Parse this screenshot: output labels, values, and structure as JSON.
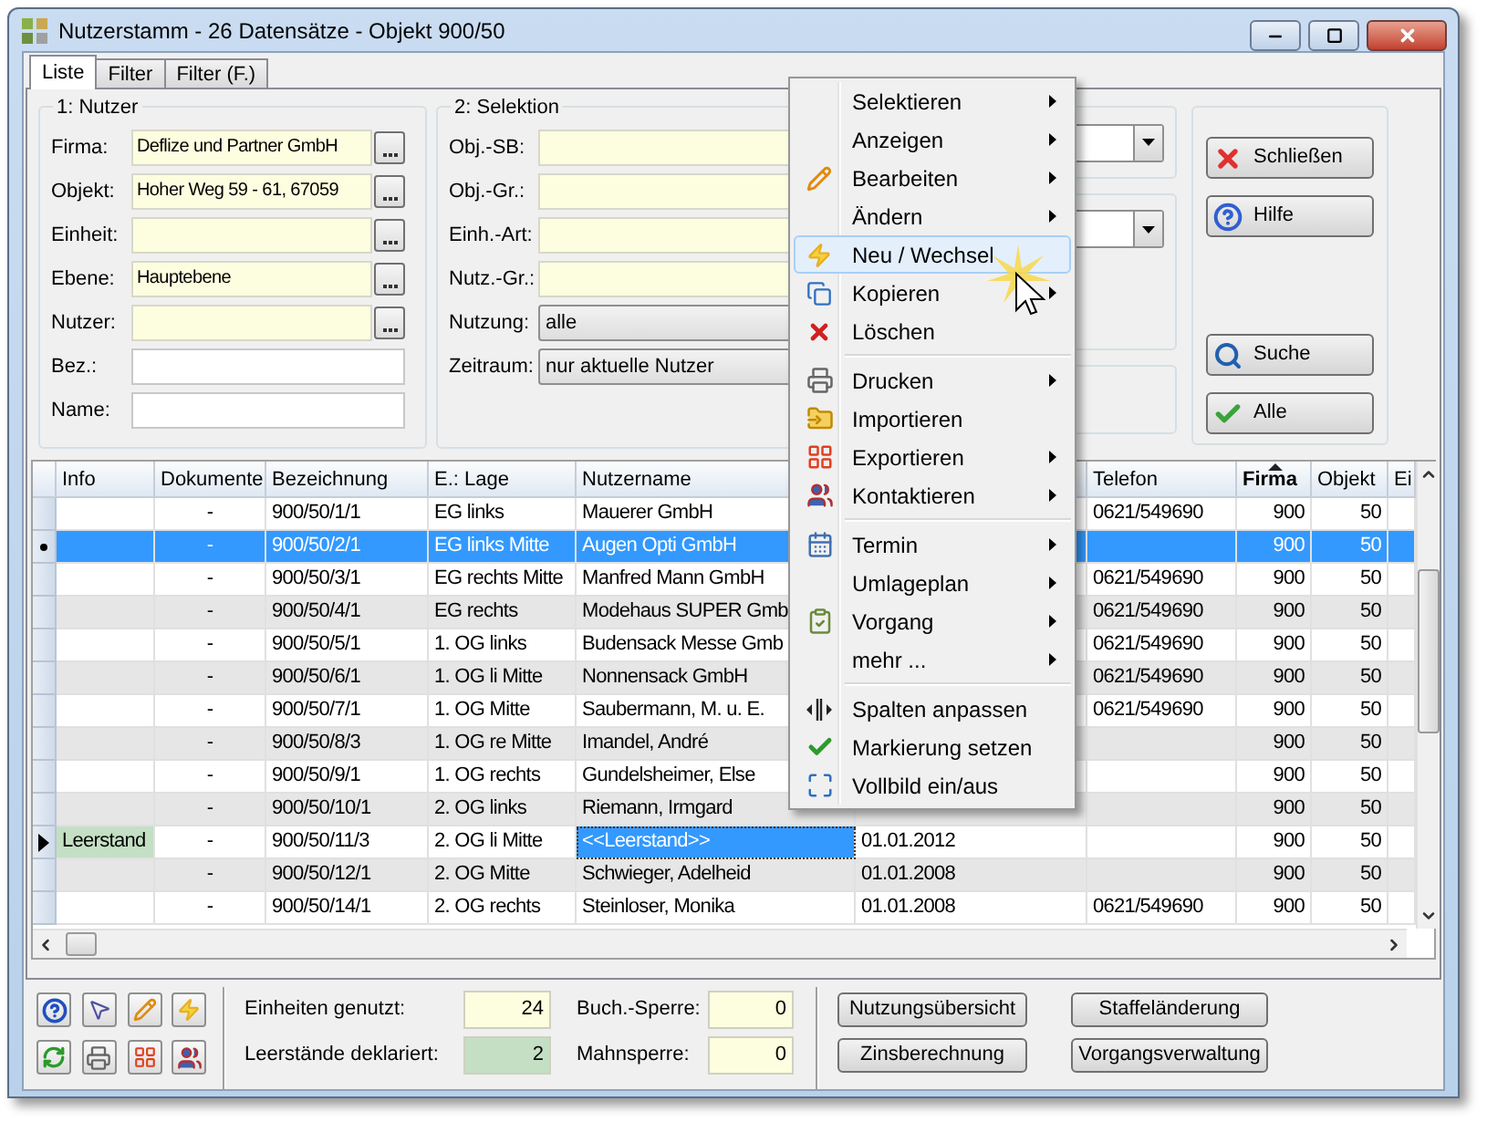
{
  "window": {
    "title": "Nutzerstamm - 26 Datensätze - Objekt 900/50"
  },
  "tabs": [
    {
      "label": "Liste",
      "selected": true
    },
    {
      "label": "Filter",
      "selected": false
    },
    {
      "label": "Filter (F.)",
      "selected": false
    }
  ],
  "group_nutzer": {
    "title": "1: Nutzer",
    "fields": [
      {
        "label": "Firma:",
        "value": "Deflize und Partner GmbH",
        "kind": "lookup"
      },
      {
        "label": "Objekt:",
        "value": "Hoher Weg 59 - 61, 67059",
        "kind": "lookup"
      },
      {
        "label": "Einheit:",
        "kind": "lookup"
      },
      {
        "label": "Ebene:",
        "value": "Hauptebene",
        "kind": "lookup"
      },
      {
        "label": "Nutzer:",
        "kind": "lookup"
      },
      {
        "label": "Bez.:",
        "kind": "text"
      },
      {
        "label": "Name:",
        "kind": "text"
      }
    ]
  },
  "group_selektion": {
    "title": "2: Selektion",
    "fields": [
      {
        "label": "Obj.-SB:",
        "kind": "lookup"
      },
      {
        "label": "Obj.-Gr.:",
        "kind": "lookup"
      },
      {
        "label": "Einh.-Art:",
        "kind": "lookup"
      },
      {
        "label": "Nutz.-Gr.:",
        "kind": "lookup"
      },
      {
        "label": "Nutzung:",
        "value": "alle",
        "kind": "combo"
      },
      {
        "label": "Zeitraum:",
        "value": "nur aktuelle Nutzer",
        "kind": "combo"
      }
    ]
  },
  "action_buttons": [
    {
      "label": "Schließen",
      "kind": "close"
    },
    {
      "label": "Hilfe",
      "kind": "help"
    },
    {
      "label": "Suche",
      "kind": "search"
    },
    {
      "label": "Alle",
      "kind": "all"
    }
  ],
  "context_menu": [
    {
      "label": "Selektieren",
      "submenu": true,
      "highlighted": false,
      "separator_before": false
    },
    {
      "label": "Anzeigen",
      "submenu": true,
      "highlighted": false,
      "separator_before": false
    },
    {
      "label": "Bearbeiten",
      "submenu": true,
      "highlighted": false,
      "separator_before": false
    },
    {
      "label": "Ändern",
      "submenu": true,
      "highlighted": false,
      "separator_before": false
    },
    {
      "label": "Neu / Wechsel",
      "submenu": false,
      "highlighted": true,
      "separator_before": false
    },
    {
      "label": "Kopieren",
      "submenu": true,
      "highlighted": false,
      "separator_before": false
    },
    {
      "label": "Löschen",
      "submenu": false,
      "highlighted": false,
      "separator_before": false
    },
    {
      "label": "Drucken",
      "submenu": true,
      "highlighted": false,
      "separator_before": true
    },
    {
      "label": "Importieren",
      "submenu": false,
      "highlighted": false,
      "separator_before": false
    },
    {
      "label": "Exportieren",
      "submenu": true,
      "highlighted": false,
      "separator_before": false
    },
    {
      "label": "Kontaktieren",
      "submenu": true,
      "highlighted": false,
      "separator_before": false
    },
    {
      "label": "Termin",
      "submenu": true,
      "highlighted": false,
      "separator_before": true
    },
    {
      "label": "Umlageplan",
      "submenu": true,
      "highlighted": false,
      "separator_before": false
    },
    {
      "label": "Vorgang",
      "submenu": true,
      "highlighted": false,
      "separator_before": false
    },
    {
      "label": "mehr ...",
      "submenu": true,
      "highlighted": false,
      "separator_before": false
    },
    {
      "label": "Spalten anpassen",
      "submenu": false,
      "highlighted": false,
      "separator_before": true
    },
    {
      "label": "Markierung setzen",
      "submenu": false,
      "highlighted": false,
      "separator_before": false
    },
    {
      "label": "Vollbild ein/aus",
      "submenu": false,
      "highlighted": false,
      "separator_before": false
    }
  ],
  "table": {
    "columns": [
      {
        "label": "Info",
        "sorted": false
      },
      {
        "label": "Dokumente",
        "sorted": false
      },
      {
        "label": "Bezeichnung",
        "sorted": false
      },
      {
        "label": "E.: Lage",
        "sorted": false
      },
      {
        "label": "Nutzername",
        "sorted": false
      },
      {
        "label": "Telefon",
        "sorted": false
      },
      {
        "label": "Firma",
        "sorted": true
      },
      {
        "label": "Objekt",
        "sorted": false
      },
      {
        "label": "Ei",
        "sorted": false
      }
    ],
    "rows": [
      {
        "selected": false,
        "vacant": false,
        "focused": false,
        "cells": {
          "dokumente": "-",
          "bezeichnung": "900/50/1/1",
          "lage": "EG links",
          "nutzername": "Mauerer GmbH",
          "telefon": "0621/549690",
          "firma": "900",
          "objekt": "50"
        }
      },
      {
        "selected": true,
        "vacant": false,
        "focused": false,
        "cells": {
          "dokumente": "-",
          "bezeichnung": "900/50/2/1",
          "lage": "EG links Mitte",
          "nutzername": "Augen Opti GmbH",
          "firma": "900",
          "objekt": "50"
        }
      },
      {
        "selected": false,
        "vacant": false,
        "focused": false,
        "cells": {
          "dokumente": "-",
          "bezeichnung": "900/50/3/1",
          "lage": "EG rechts Mitte",
          "nutzername": "Manfred Mann GmbH",
          "telefon": "0621/549690",
          "firma": "900",
          "objekt": "50"
        }
      },
      {
        "selected": false,
        "vacant": false,
        "focused": false,
        "cells": {
          "dokumente": "-",
          "bezeichnung": "900/50/4/1",
          "lage": "EG rechts",
          "nutzername": "Modehaus SUPER Gmb",
          "telefon": "0621/549690",
          "firma": "900",
          "objekt": "50"
        }
      },
      {
        "selected": false,
        "vacant": false,
        "focused": false,
        "cells": {
          "dokumente": "-",
          "bezeichnung": "900/50/5/1",
          "lage": "1. OG links",
          "nutzername": "Budensack Messe Gmb",
          "telefon": "0621/549690",
          "firma": "900",
          "objekt": "50"
        }
      },
      {
        "selected": false,
        "vacant": false,
        "focused": false,
        "cells": {
          "dokumente": "-",
          "bezeichnung": "900/50/6/1",
          "lage": "1. OG li Mitte",
          "nutzername": "Nonnensack GmbH",
          "telefon": "0621/549690",
          "firma": "900",
          "objekt": "50"
        }
      },
      {
        "selected": false,
        "vacant": false,
        "focused": false,
        "cells": {
          "dokumente": "-",
          "bezeichnung": "900/50/7/1",
          "lage": "1. OG Mitte",
          "nutzername": "Saubermann, M. u. E.",
          "telefon": "0621/549690",
          "firma": "900",
          "objekt": "50"
        }
      },
      {
        "selected": false,
        "vacant": false,
        "focused": false,
        "cells": {
          "dokumente": "-",
          "bezeichnung": "900/50/8/3",
          "lage": "1. OG re Mitte",
          "nutzername": "Imandel, André",
          "firma": "900",
          "objekt": "50"
        }
      },
      {
        "selected": false,
        "vacant": false,
        "focused": false,
        "cells": {
          "dokumente": "-",
          "bezeichnung": "900/50/9/1",
          "lage": "1. OG rechts",
          "nutzername": "Gundelsheimer, Else",
          "firma": "900",
          "objekt": "50"
        }
      },
      {
        "selected": false,
        "vacant": false,
        "focused": false,
        "cells": {
          "dokumente": "-",
          "bezeichnung": "900/50/10/1",
          "lage": "2. OG links",
          "nutzername": "Riemann, Irmgard",
          "firma": "900",
          "objekt": "50"
        }
      },
      {
        "selected": false,
        "vacant": true,
        "focused": true,
        "cells": {
          "info": "Leerstand",
          "dokumente": "-",
          "bezeichnung": "900/50/11/3",
          "lage": "2. OG li Mitte",
          "nutzername": "<<Leerstand>>",
          "column_6": "01.01.2012",
          "firma": "900",
          "objekt": "50"
        }
      },
      {
        "selected": false,
        "vacant": false,
        "focused": false,
        "cells": {
          "dokumente": "-",
          "bezeichnung": "900/50/12/1",
          "lage": "2. OG Mitte",
          "nutzername": "Schwieger, Adelheid",
          "column_6": "01.01.2008",
          "firma": "900",
          "objekt": "50"
        }
      },
      {
        "selected": false,
        "vacant": false,
        "focused": false,
        "cells": {
          "dokumente": "-",
          "bezeichnung": "900/50/14/1",
          "lage": "2. OG rechts",
          "nutzername": "Steinloser, Monika",
          "column_6": "01.01.2008",
          "telefon": "0621/549690",
          "firma": "900",
          "objekt": "50"
        }
      }
    ]
  },
  "stats": [
    {
      "label": "Einheiten genutzt:",
      "value": "24",
      "highlighted": false
    },
    {
      "label": "Buch.-Sperre:",
      "value": "0",
      "highlighted": false
    },
    {
      "label": "Leerstände deklariert:",
      "value": "2",
      "highlighted": true
    },
    {
      "label": "Mahnsperre:",
      "value": "0",
      "highlighted": false
    }
  ],
  "bottom_buttons": [
    {
      "label": "Nutzungsübersicht"
    },
    {
      "label": "Staffeländerung"
    },
    {
      "label": "Zinsberechnung"
    },
    {
      "label": "Vorgangsverwaltung"
    }
  ]
}
